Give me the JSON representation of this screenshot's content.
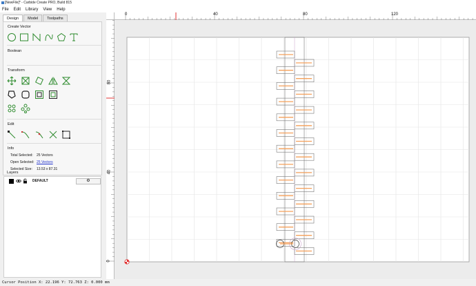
{
  "window": {
    "title": "[NewFile]* - Carbide Create PRO, Build 815"
  },
  "menu": [
    "File",
    "Edit",
    "Library",
    "View",
    "Help"
  ],
  "tabs": [
    {
      "label": "Design",
      "active": true
    },
    {
      "label": "Model",
      "active": false
    },
    {
      "label": "Toolpaths",
      "active": false
    }
  ],
  "sections": {
    "create_vector": "Create Vector",
    "boolean": "Boolean",
    "transform": "Transform",
    "edit": "Edit",
    "info": "Info",
    "layers": "Layers"
  },
  "info": {
    "total_selected_label": "Total Selected:",
    "total_selected_value": "25 Vectors",
    "open_selected_label": "Open Selected:",
    "open_selected_value": "25 Vectors",
    "selected_size_label": "Selected Size:",
    "selected_size_value": "13.53 x 87.31"
  },
  "layers": [
    {
      "name": "DEFAULT",
      "color": "#000000"
    }
  ],
  "rulers": {
    "top_labels": [
      "0",
      "40",
      "80",
      "120"
    ],
    "left_labels": [
      "80",
      "40",
      "0"
    ]
  },
  "status": {
    "text": "Cursor Position X: 22.196 Y: 72.763 Z: 0.000 mm"
  },
  "colors": {
    "accent_green": "#2e8b2e",
    "toolpath_orange": "#f5a05a",
    "marker_red": "#e03030",
    "link_blue": "#2233cc"
  }
}
